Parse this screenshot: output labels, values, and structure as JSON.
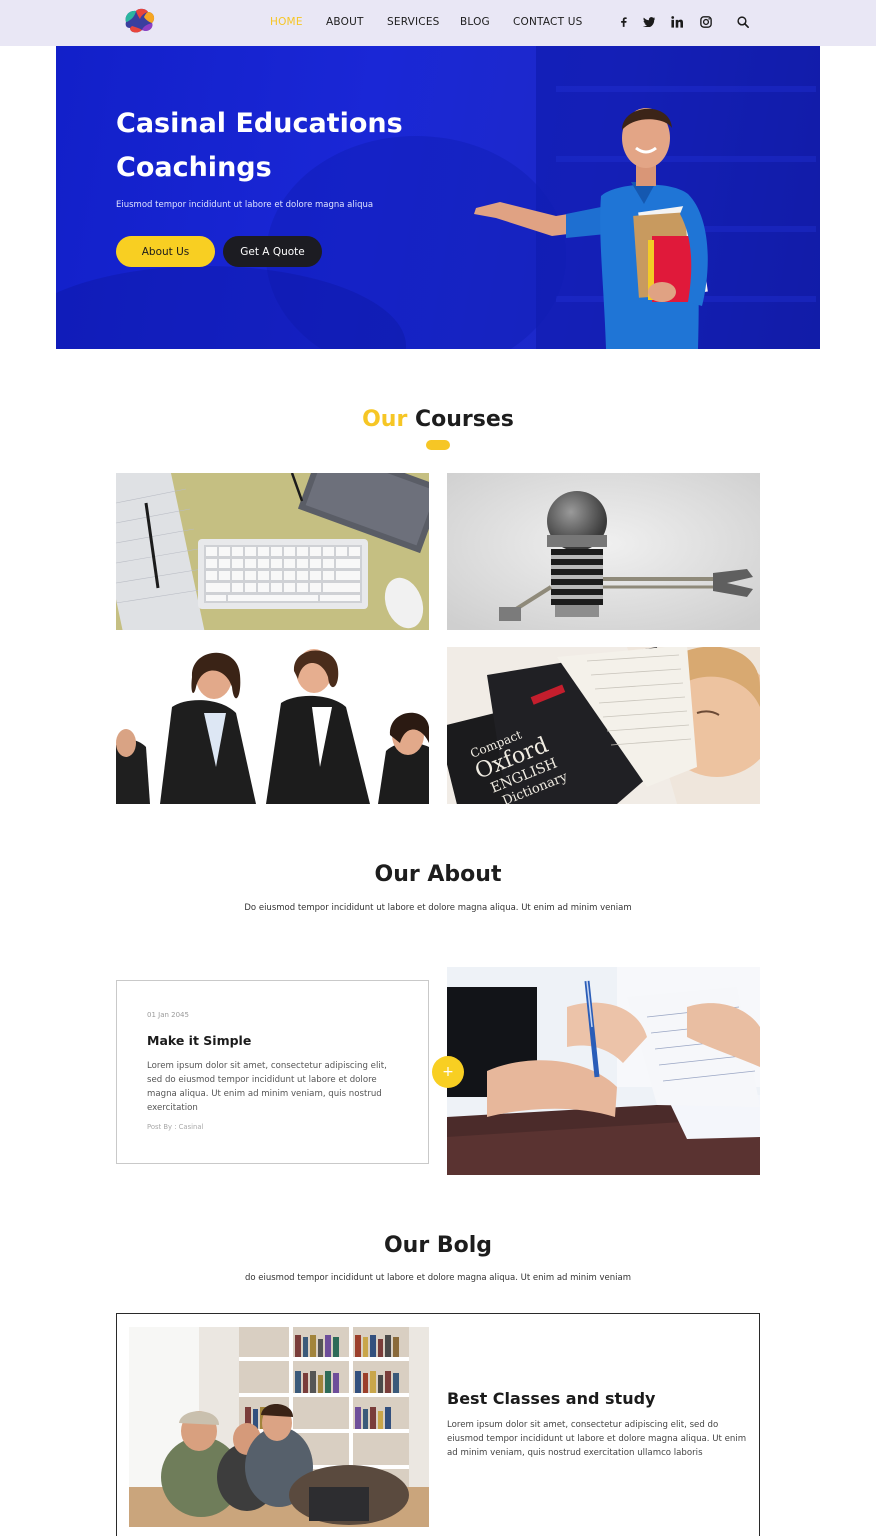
{
  "nav": {
    "items": [
      {
        "label": "HOME",
        "active": true
      },
      {
        "label": "ABOUT",
        "active": false
      },
      {
        "label": "SERVICES",
        "active": false
      },
      {
        "label": "BLOG",
        "active": false
      },
      {
        "label": "CONTACT US",
        "active": false
      }
    ],
    "social_icons": [
      "facebook-icon",
      "twitter-icon",
      "linkedin-icon",
      "instagram-icon"
    ],
    "search_icon": "search-icon"
  },
  "hero": {
    "title": "Casinal Educations Coachings",
    "subtitle": "Eiusmod tempor incididunt ut labore et dolore magna aliqua",
    "primary_button": "About Us",
    "secondary_button": "Get A Quote"
  },
  "courses": {
    "title_highlight": "Our",
    "title_rest": "Courses",
    "items": [
      "keyboard-desk-photo",
      "robot-photo",
      "business-women-photo",
      "dictionary-reader-photo"
    ]
  },
  "about": {
    "title": "Our About",
    "subtitle": "Do eiusmod tempor incididunt ut labore et dolore magna aliqua. Ut enim ad minim veniam",
    "card": {
      "date": "01 Jan 2045",
      "heading": "Make it Simple",
      "text": "Lorem ipsum dolor sit amet, consectetur adipiscing elit, sed do eiusmod tempor incididunt ut labore et dolore magna aliqua. Ut enim ad minim veniam, quis nostrud exercitation",
      "post_by": "Post By : Casinal"
    },
    "plus_label": "+"
  },
  "blog": {
    "title": "Our Bolg",
    "subtitle": "do eiusmod tempor incididunt ut labore et dolore magna aliqua. Ut enim ad minim veniam",
    "card": {
      "heading": "Best Classes and study",
      "text": "Lorem ipsum dolor sit amet, consectetur adipiscing elit, sed do eiusmod tempor incididunt ut labore et dolore magna aliqua. Ut enim ad minim veniam, quis nostrud exercitation ullamco laboris"
    }
  },
  "colors": {
    "accent": "#f6c625",
    "hero_blue": "#1a27d6",
    "header_bg": "#e9e7f5",
    "dark": "#1c1c22"
  }
}
